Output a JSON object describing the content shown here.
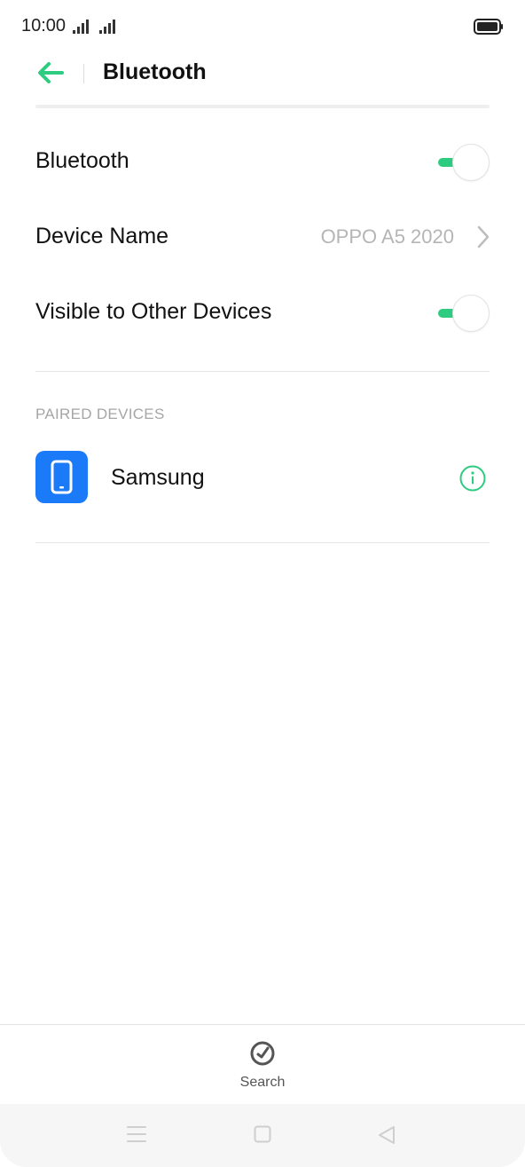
{
  "status_bar": {
    "time": "10:00"
  },
  "header": {
    "title": "Bluetooth"
  },
  "settings": [
    {
      "label": "Bluetooth",
      "toggle_on": true
    },
    {
      "label": "Device Name",
      "value": "OPPO A5 2020"
    },
    {
      "label": "Visible to Other Devices",
      "toggle_on": true
    }
  ],
  "paired": {
    "section_label": "PAIRED DEVICES",
    "devices": [
      {
        "name": "Samsung",
        "icon": "phone-icon"
      }
    ]
  },
  "bottom_bar": {
    "search_label": "Search",
    "icon": "search-radar-icon"
  },
  "nav": {
    "icons": [
      "menu-icon",
      "home-icon",
      "back-triangle-icon"
    ]
  },
  "colors": {
    "accent": "#2ecc80",
    "device_icon_bg": "#1a7af8"
  }
}
